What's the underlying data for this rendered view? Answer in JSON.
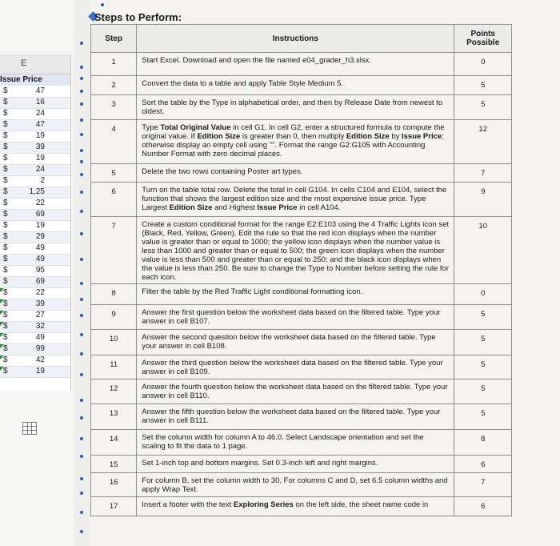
{
  "header": {
    "title": "Steps to Perform:"
  },
  "table": {
    "step_header": "Step",
    "instructions_header": "Instructions",
    "points_header": "Points Possible",
    "rows": [
      {
        "step": "1",
        "points": "0",
        "text": "Start Excel. Download and open the file named e04_grader_h3.xlsx."
      },
      {
        "step": "2",
        "points": "5",
        "text": "Convert the data to a table and apply Table Style Medium 5."
      },
      {
        "step": "3",
        "points": "5",
        "text": "Sort the table by the Type in alphabetical order, and then by Release Date from newest to oldest."
      },
      {
        "step": "4",
        "points": "12",
        "text": "Type Total Original Value in cell G1. In cell G2, enter a structured formula to compute the original value. If Edition Size is greater than 0, then multiply Edition Size by Issue Price; otherwise display an empty cell using \"\". Format the range G2:G105 with Accounting Number Format with zero decimal places."
      },
      {
        "step": "5",
        "points": "7",
        "text": "Delete the two rows containing Poster art types."
      },
      {
        "step": "6",
        "points": "9",
        "text": "Turn on the table total row. Delete the total in cell G104. In cells C104 and E104, select the function that shows the largest edition size and the most expensive issue price. Type Largest Edition Size and Highest Issue Price in cell A104."
      },
      {
        "step": "7",
        "points": "10",
        "text": "Create a custom conditional format for the range E2:E103 using the 4 Traffic Lights icon set (Black, Red, Yellow, Green). Edit the rule so that the red icon displays when the number value is greater than or equal to 1000; the yellow icon displays when the number value is less than 1000 and greater than or equal to 500; the green icon displays when the number value is less than 500 and greater than or equal to 250; and the black icon displays when the value is less than 250. Be sure to change the Type to Number before setting the rule for each icon."
      },
      {
        "step": "8",
        "points": "0",
        "text": "Filter the table by the Red Traffic Light conditional formatting icon."
      },
      {
        "step": "9",
        "points": "5",
        "text": "Answer the first question below the worksheet data based on the filtered table. Type your answer in cell B107."
      },
      {
        "step": "10",
        "points": "5",
        "text": "Answer the second question below the worksheet data based on the filtered table. Type your answer in cell B108."
      },
      {
        "step": "11",
        "points": "5",
        "text": "Answer the third question below the worksheet data based on the filtered table. Type your answer in cell B109."
      },
      {
        "step": "12",
        "points": "5",
        "text": "Answer the fourth question below the worksheet data based on the filtered table. Type your answer in cell B110."
      },
      {
        "step": "13",
        "points": "5",
        "text": "Answer the fifth question below the worksheet data based on the filtered table. Type your answer in cell B111."
      },
      {
        "step": "14",
        "points": "8",
        "text": "Set the column width for column A to 46.0. Select Landscape orientation and set the scaling to fit the data to 1 page."
      },
      {
        "step": "15",
        "points": "6",
        "text": "Set 1-inch top and bottom margins. Set 0.3-inch left and right margins."
      },
      {
        "step": "16",
        "points": "7",
        "text": "For column B, set the column width to 30. For columns C and D, set 6.5 column widths and apply Wrap Text."
      },
      {
        "step": "17",
        "points": "6",
        "text": "Insert a footer with the text Exploring Series on the left side, the sheet name code in"
      }
    ]
  },
  "excel": {
    "column_letter": "E",
    "header": "Issue Price",
    "currency": "$",
    "values": [
      "47",
      "16",
      "24",
      "47",
      "19",
      "39",
      "19",
      "24",
      "2",
      "1,25",
      "22",
      "69",
      "19",
      "29",
      "49",
      "49",
      "95",
      "69",
      "22",
      "39",
      "27",
      "32",
      "49",
      "99",
      "42",
      "19"
    ]
  }
}
